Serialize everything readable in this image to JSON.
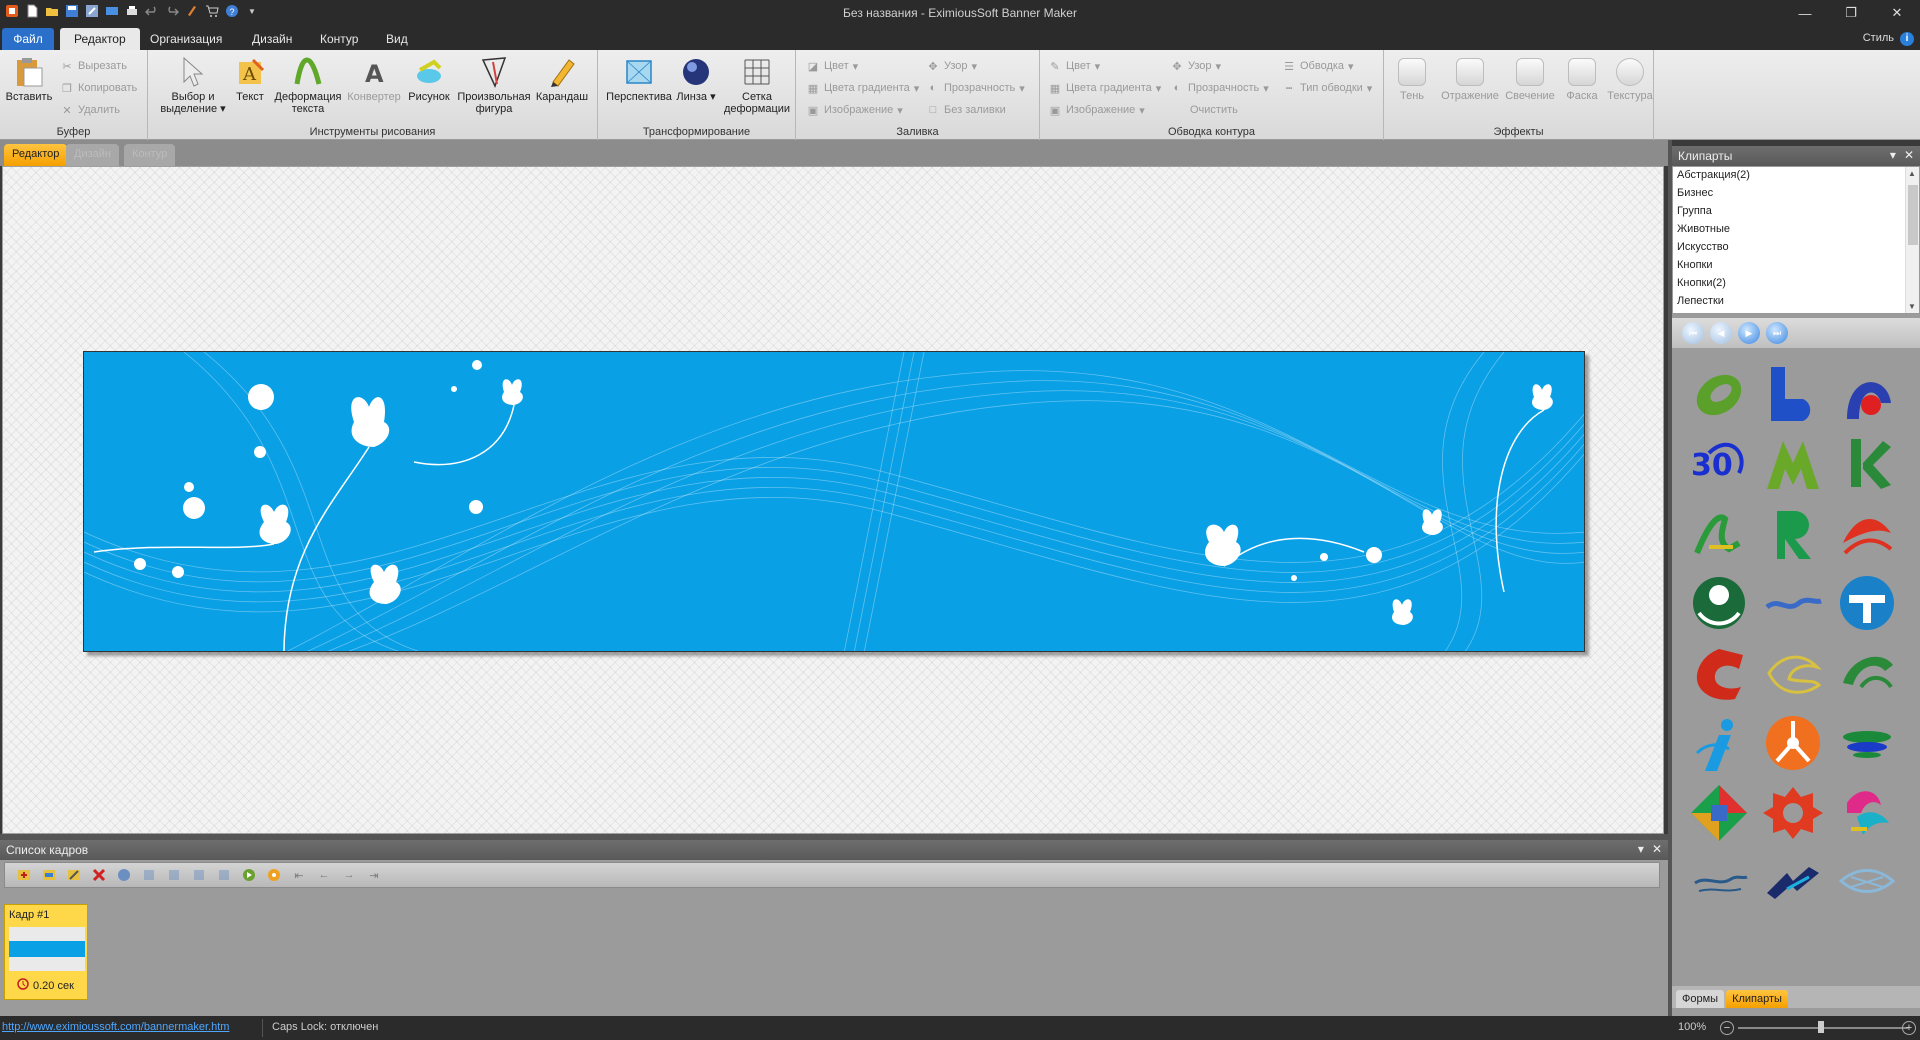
{
  "window": {
    "title": "Без названия - EximiousSoft Banner Maker"
  },
  "ribbon_tabs": {
    "file": "Файл",
    "editor": "Редактор",
    "organize": "Организация",
    "design": "Дизайн",
    "contour": "Контур",
    "view": "Вид",
    "style": "Стиль"
  },
  "ribbon": {
    "buffer": {
      "label": "Буфер",
      "paste": "Вставить",
      "cut": "Вырезать",
      "copy": "Копировать",
      "delete": "Удалить"
    },
    "drawing": {
      "label": "Инструменты рисования",
      "select": "Выбор и выделение",
      "text": "Текст",
      "text_warp": "Деформация текста",
      "converter": "Конвертер",
      "picture": "Рисунок",
      "freeform": "Произвольная фигура",
      "pencil": "Карандаш"
    },
    "transform": {
      "label": "Трансформирование",
      "perspective": "Перспектива",
      "lens": "Линза",
      "warp_grid": "Сетка деформации"
    },
    "fill": {
      "label": "Заливка",
      "color": "Цвет",
      "pattern": "Узор",
      "gradient_colors": "Цвета градиента",
      "transparency": "Прозрачность",
      "image": "Изображение",
      "no_fill": "Без заливки"
    },
    "outline": {
      "label": "Обводка контура",
      "color": "Цвет",
      "pattern": "Узор",
      "stroke": "Обводка",
      "gradient_colors": "Цвета градиента",
      "transparency": "Прозрачность",
      "stroke_type": "Тип обводки",
      "image": "Изображение",
      "clear": "Очистить"
    },
    "effects": {
      "label": "Эффекты",
      "shadow": "Тень",
      "reflection": "Отражение",
      "glow": "Свечение",
      "bevel": "Фаска",
      "texture": "Текстура"
    }
  },
  "doc_tabs": [
    "Редактор",
    "Дизайн",
    "Контур"
  ],
  "frames_panel": {
    "title": "Список кадров",
    "frames": [
      {
        "label": "Кадр #1",
        "duration": "0.20 сек"
      }
    ]
  },
  "clipart_panel": {
    "title": "Клипарты",
    "categories": [
      "Абстракция(2)",
      "Бизнес",
      "Группа",
      "Животные",
      "Искусство",
      "Кнопки",
      "Кнопки(2)",
      "Лепестки"
    ],
    "bottom_tabs": [
      "Формы",
      "Клипарты"
    ]
  },
  "status": {
    "url": "http://www.eximioussoft.com/bannermaker.htm",
    "caps_lock": "Caps Lock: отключен",
    "zoom": "100%"
  },
  "colors": {
    "banner_blue": "#0aa0e6",
    "accent_orange": "#f5a000",
    "file_tab_blue": "#2a6fc9"
  }
}
